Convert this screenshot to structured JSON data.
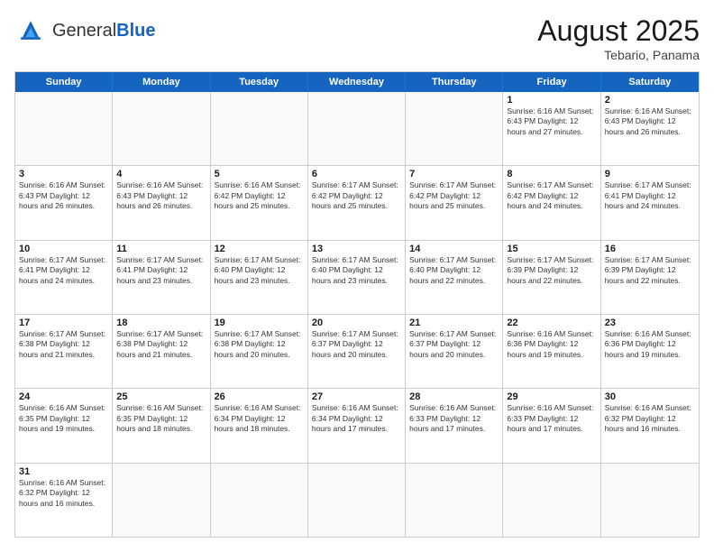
{
  "header": {
    "logo_general": "General",
    "logo_blue": "Blue",
    "month_year": "August 2025",
    "location": "Tebario, Panama"
  },
  "calendar": {
    "weekdays": [
      "Sunday",
      "Monday",
      "Tuesday",
      "Wednesday",
      "Thursday",
      "Friday",
      "Saturday"
    ],
    "rows": [
      [
        {
          "day": "",
          "info": ""
        },
        {
          "day": "",
          "info": ""
        },
        {
          "day": "",
          "info": ""
        },
        {
          "day": "",
          "info": ""
        },
        {
          "day": "",
          "info": ""
        },
        {
          "day": "1",
          "info": "Sunrise: 6:16 AM\nSunset: 6:43 PM\nDaylight: 12 hours\nand 27 minutes."
        },
        {
          "day": "2",
          "info": "Sunrise: 6:16 AM\nSunset: 6:43 PM\nDaylight: 12 hours\nand 26 minutes."
        }
      ],
      [
        {
          "day": "3",
          "info": "Sunrise: 6:16 AM\nSunset: 6:43 PM\nDaylight: 12 hours\nand 26 minutes."
        },
        {
          "day": "4",
          "info": "Sunrise: 6:16 AM\nSunset: 6:43 PM\nDaylight: 12 hours\nand 26 minutes."
        },
        {
          "day": "5",
          "info": "Sunrise: 6:16 AM\nSunset: 6:42 PM\nDaylight: 12 hours\nand 25 minutes."
        },
        {
          "day": "6",
          "info": "Sunrise: 6:17 AM\nSunset: 6:42 PM\nDaylight: 12 hours\nand 25 minutes."
        },
        {
          "day": "7",
          "info": "Sunrise: 6:17 AM\nSunset: 6:42 PM\nDaylight: 12 hours\nand 25 minutes."
        },
        {
          "day": "8",
          "info": "Sunrise: 6:17 AM\nSunset: 6:42 PM\nDaylight: 12 hours\nand 24 minutes."
        },
        {
          "day": "9",
          "info": "Sunrise: 6:17 AM\nSunset: 6:41 PM\nDaylight: 12 hours\nand 24 minutes."
        }
      ],
      [
        {
          "day": "10",
          "info": "Sunrise: 6:17 AM\nSunset: 6:41 PM\nDaylight: 12 hours\nand 24 minutes."
        },
        {
          "day": "11",
          "info": "Sunrise: 6:17 AM\nSunset: 6:41 PM\nDaylight: 12 hours\nand 23 minutes."
        },
        {
          "day": "12",
          "info": "Sunrise: 6:17 AM\nSunset: 6:40 PM\nDaylight: 12 hours\nand 23 minutes."
        },
        {
          "day": "13",
          "info": "Sunrise: 6:17 AM\nSunset: 6:40 PM\nDaylight: 12 hours\nand 23 minutes."
        },
        {
          "day": "14",
          "info": "Sunrise: 6:17 AM\nSunset: 6:40 PM\nDaylight: 12 hours\nand 22 minutes."
        },
        {
          "day": "15",
          "info": "Sunrise: 6:17 AM\nSunset: 6:39 PM\nDaylight: 12 hours\nand 22 minutes."
        },
        {
          "day": "16",
          "info": "Sunrise: 6:17 AM\nSunset: 6:39 PM\nDaylight: 12 hours\nand 22 minutes."
        }
      ],
      [
        {
          "day": "17",
          "info": "Sunrise: 6:17 AM\nSunset: 6:38 PM\nDaylight: 12 hours\nand 21 minutes."
        },
        {
          "day": "18",
          "info": "Sunrise: 6:17 AM\nSunset: 6:38 PM\nDaylight: 12 hours\nand 21 minutes."
        },
        {
          "day": "19",
          "info": "Sunrise: 6:17 AM\nSunset: 6:38 PM\nDaylight: 12 hours\nand 20 minutes."
        },
        {
          "day": "20",
          "info": "Sunrise: 6:17 AM\nSunset: 6:37 PM\nDaylight: 12 hours\nand 20 minutes."
        },
        {
          "day": "21",
          "info": "Sunrise: 6:17 AM\nSunset: 6:37 PM\nDaylight: 12 hours\nand 20 minutes."
        },
        {
          "day": "22",
          "info": "Sunrise: 6:16 AM\nSunset: 6:36 PM\nDaylight: 12 hours\nand 19 minutes."
        },
        {
          "day": "23",
          "info": "Sunrise: 6:16 AM\nSunset: 6:36 PM\nDaylight: 12 hours\nand 19 minutes."
        }
      ],
      [
        {
          "day": "24",
          "info": "Sunrise: 6:16 AM\nSunset: 6:35 PM\nDaylight: 12 hours\nand 19 minutes."
        },
        {
          "day": "25",
          "info": "Sunrise: 6:16 AM\nSunset: 6:35 PM\nDaylight: 12 hours\nand 18 minutes."
        },
        {
          "day": "26",
          "info": "Sunrise: 6:16 AM\nSunset: 6:34 PM\nDaylight: 12 hours\nand 18 minutes."
        },
        {
          "day": "27",
          "info": "Sunrise: 6:16 AM\nSunset: 6:34 PM\nDaylight: 12 hours\nand 17 minutes."
        },
        {
          "day": "28",
          "info": "Sunrise: 6:16 AM\nSunset: 6:33 PM\nDaylight: 12 hours\nand 17 minutes."
        },
        {
          "day": "29",
          "info": "Sunrise: 6:16 AM\nSunset: 6:33 PM\nDaylight: 12 hours\nand 17 minutes."
        },
        {
          "day": "30",
          "info": "Sunrise: 6:16 AM\nSunset: 6:32 PM\nDaylight: 12 hours\nand 16 minutes."
        }
      ],
      [
        {
          "day": "31",
          "info": "Sunrise: 6:16 AM\nSunset: 6:32 PM\nDaylight: 12 hours\nand 16 minutes."
        },
        {
          "day": "",
          "info": ""
        },
        {
          "day": "",
          "info": ""
        },
        {
          "day": "",
          "info": ""
        },
        {
          "day": "",
          "info": ""
        },
        {
          "day": "",
          "info": ""
        },
        {
          "day": "",
          "info": ""
        }
      ]
    ]
  }
}
